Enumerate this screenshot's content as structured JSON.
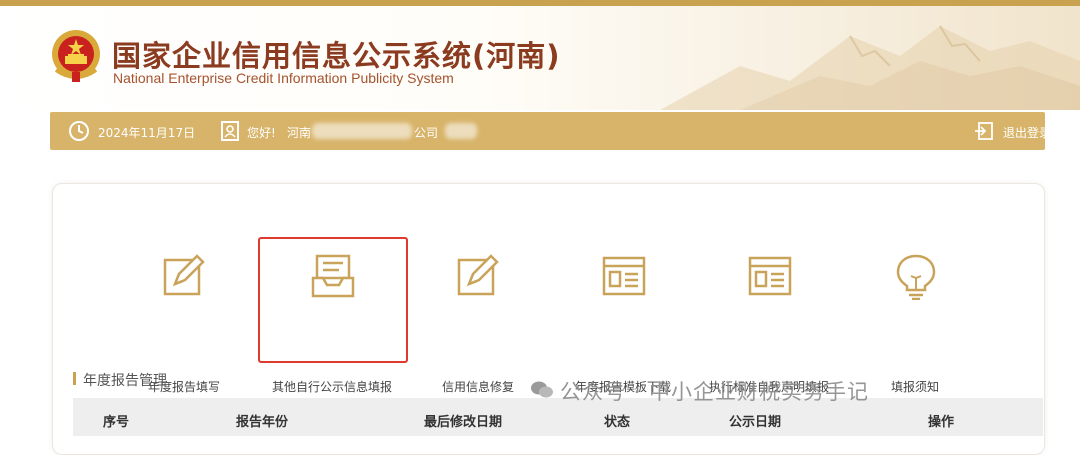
{
  "header": {
    "title_cn": "国家企业信用信息公示系统(河南)",
    "title_en": "National Enterprise Credit Information Publicity System"
  },
  "infobar": {
    "date": "2024年11月17日",
    "greeting_prefix": "您好!",
    "company_fragment_start": "河南",
    "company_fragment_end": "公司",
    "logout_label": "退出登录"
  },
  "tiles": [
    {
      "label": "年度报告填写",
      "icon": "edit-icon"
    },
    {
      "label": "其他自行公示信息填报",
      "icon": "inbox-icon"
    },
    {
      "label": "信用信息修复",
      "icon": "edit-icon"
    },
    {
      "label": "年度报告模板下载",
      "icon": "template-icon"
    },
    {
      "label": "执行标准自我声明填报",
      "icon": "template-icon"
    },
    {
      "label": "填报须知",
      "icon": "lightbulb-icon"
    }
  ],
  "section": {
    "title": "年度报告管理"
  },
  "table": {
    "columns": [
      "序号",
      "报告年份",
      "最后修改日期",
      "状态",
      "公示日期",
      "操作"
    ]
  },
  "watermark": {
    "text": "公众号 · 中小企业财税实务手记"
  },
  "colors": {
    "gold": "#d8b46a",
    "title_red": "#8b3b1f",
    "highlight": "#e03a2f"
  }
}
